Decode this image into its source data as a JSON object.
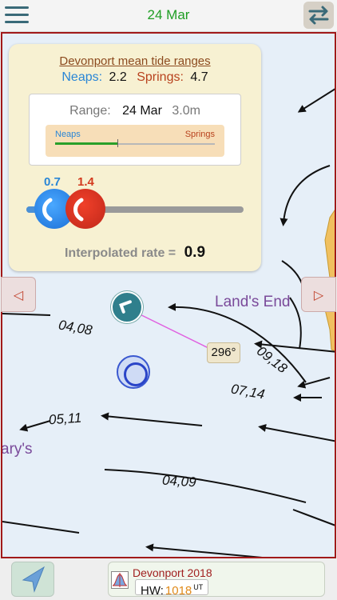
{
  "header": {
    "date": "24 Mar",
    "icons": {
      "menu": "menu-icon",
      "swap": "swap-icon"
    }
  },
  "panel": {
    "title": "Devonport mean tide ranges",
    "neaps_label": "Neaps:",
    "neaps_value": "2.2",
    "springs_label": "Springs:",
    "springs_value": "4.7",
    "range": {
      "label": "Range:",
      "date": "24 Mar",
      "value": "3.0m",
      "bar_neaps": "Neaps",
      "bar_springs": "Springs",
      "position_fraction": 0.39
    },
    "slider": {
      "neaps_rate": "0.7",
      "springs_rate": "1.4"
    },
    "interpolated_label": "Interpolated rate =",
    "interpolated_value": "0.9"
  },
  "map": {
    "places": [
      "Land's End",
      "ary's"
    ],
    "stream_rates": [
      "04,08",
      "09,18",
      "07,14",
      "05,11",
      "04,09"
    ],
    "bearing": "296°",
    "colors": {
      "border": "#a11a1a",
      "sea": "#e6eff8",
      "land": "#f0c060"
    }
  },
  "nav": {
    "prev": "◁",
    "next": "▷"
  },
  "footer": {
    "station": "Devonport 2018",
    "hw_label": "HW:",
    "hw_time": "1018",
    "hw_unit": "UT"
  }
}
